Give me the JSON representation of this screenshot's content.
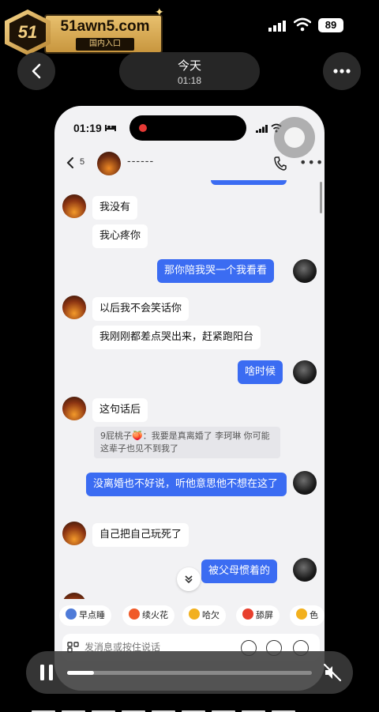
{
  "watermark": {
    "brand": "51awn5.com",
    "badge": "51",
    "subtitle": "国内入口"
  },
  "outer_status": {
    "battery": "89"
  },
  "nav": {
    "title": "今天",
    "subtitle": "01:18"
  },
  "inner_phone": {
    "status_time": "01:19",
    "chat": {
      "unread_count": "5",
      "contact_name": "------"
    },
    "messages": [
      {
        "side": "in",
        "text": "我没有"
      },
      {
        "side": "in",
        "text": "我心疼你"
      },
      {
        "side": "out",
        "text": "那你陪我哭一个我看看"
      },
      {
        "side": "in",
        "text": "以后我不会笑话你"
      },
      {
        "side": "in",
        "text": "我刚刚都差点哭出来，赶紧跑阳台"
      },
      {
        "side": "out",
        "text": "啥时候"
      },
      {
        "side": "in",
        "text": "这句话后"
      },
      {
        "side": "quote",
        "text": "9屁桃子🍑：我要是真离婚了 李珂琳 你可能这辈子也见不到我了"
      },
      {
        "side": "out",
        "text": "没离婚也不好说，听他意思他不想在这了"
      },
      {
        "side": "in",
        "text": "自己把自己玩死了"
      },
      {
        "side": "out",
        "text": "被父母惯着的"
      }
    ],
    "quick_replies": [
      {
        "label": "早点睡",
        "color": "#4f7bd8"
      },
      {
        "label": "续火花",
        "color": "#f05a28"
      },
      {
        "label": "哈欠",
        "color": "#f2b01e"
      },
      {
        "label": "舔屏",
        "color": "#e8402e"
      },
      {
        "label": "色",
        "color": "#f2b01e"
      }
    ],
    "input_placeholder": "发消息或按住说话"
  },
  "video_player": {
    "progress": 0.11,
    "state": "playing",
    "muted": true
  }
}
